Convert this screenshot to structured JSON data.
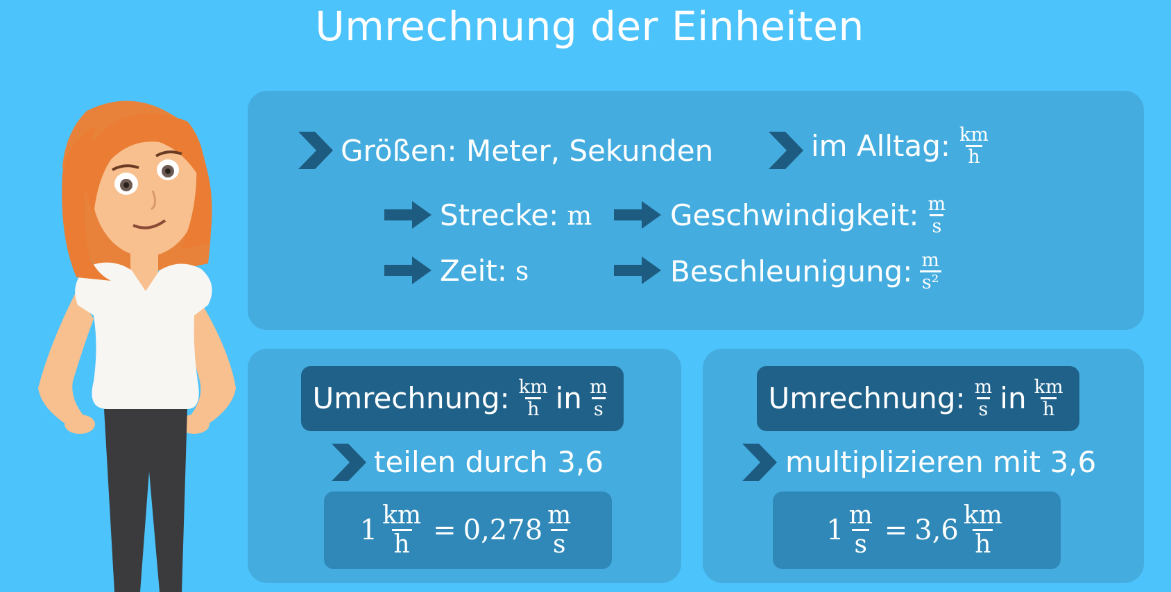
{
  "title": "Umrechnung der Einheiten",
  "top_panel": {
    "groessen": "Größen: Meter, Sekunden",
    "alltag": "im Alltag:",
    "alltag_num": "km",
    "alltag_den": "h",
    "strecke": "Strecke:",
    "strecke_unit": "m",
    "zeit": "Zeit:",
    "zeit_unit": "s",
    "geschw": "Geschwindigkeit:",
    "geschw_num": "m",
    "geschw_den": "s",
    "beschl": "Beschleunigung:",
    "beschl_num": "m",
    "beschl_den": "s²"
  },
  "left_box": {
    "label": "Umrechnung:",
    "from_num": "km",
    "from_den": "h",
    "in": "in",
    "to_num": "m",
    "to_den": "s",
    "rule": "teilen durch 3,6",
    "eq_lhs": "1",
    "eq_lhs_num": "km",
    "eq_lhs_den": "h",
    "eq_sign": "=",
    "eq_rhs": "0,278",
    "eq_rhs_num": "m",
    "eq_rhs_den": "s"
  },
  "right_box": {
    "label": "Umrechnung:",
    "from_num": "m",
    "from_den": "s",
    "in": "in",
    "to_num": "km",
    "to_den": "h",
    "rule": "multiplizieren mit 3,6",
    "eq_lhs": "1",
    "eq_lhs_num": "m",
    "eq_lhs_den": "s",
    "eq_sign": "=",
    "eq_rhs": "3,6",
    "eq_rhs_num": "km",
    "eq_rhs_den": "h"
  },
  "colors": {
    "background": "#4dc3fb",
    "panel": "#44acde",
    "dark_box": "#1f6188",
    "formula_box": "#2f88b8",
    "arrow": "#1e5b80"
  },
  "icons": [
    "chevron-right-icon",
    "arrow-right-icon",
    "teacher-character-illustration"
  ]
}
